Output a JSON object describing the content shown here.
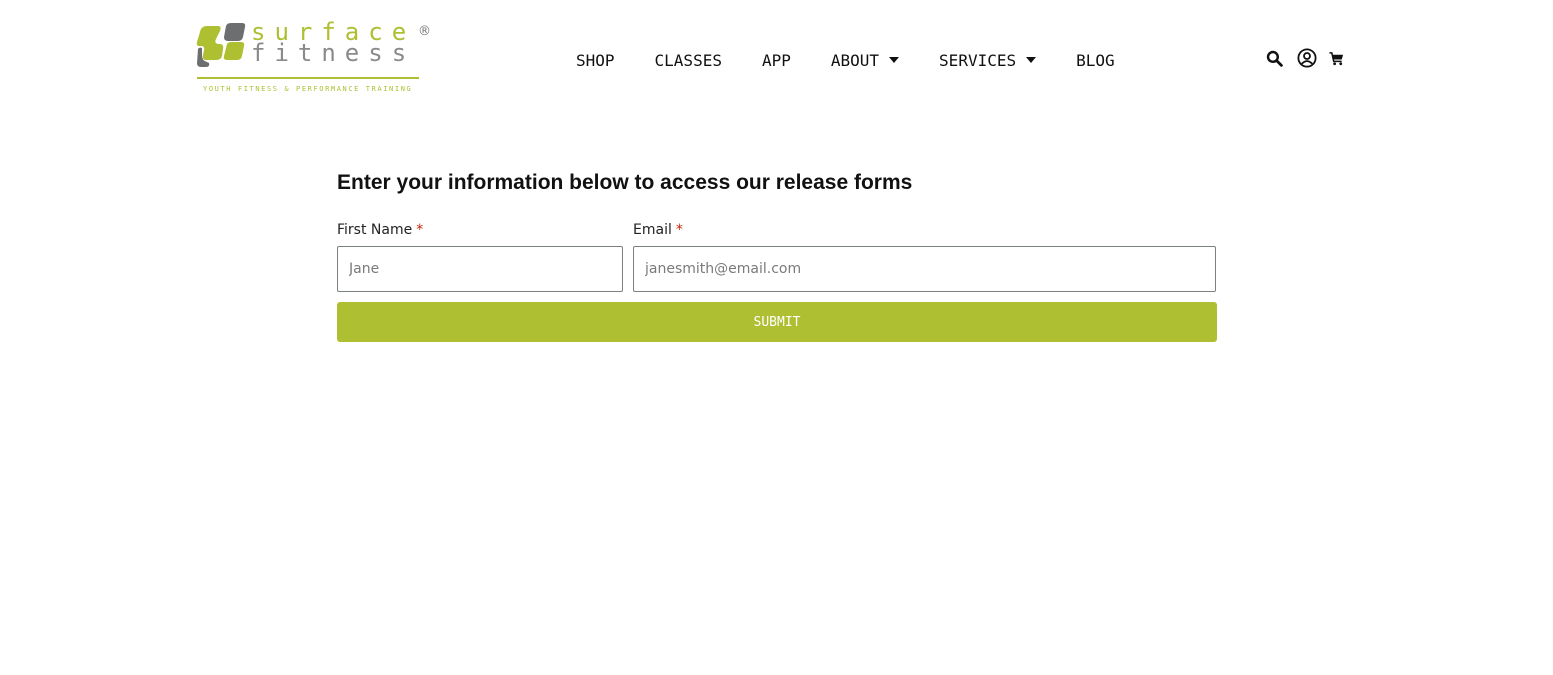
{
  "brand": {
    "name_line1": "surface",
    "name_line2": "fitness",
    "registered": "®",
    "tagline": "YOUTH FITNESS & PERFORMANCE TRAINING",
    "primary_color": "#aebf32",
    "secondary_color": "#6d6e70"
  },
  "nav": {
    "items": [
      {
        "label": "SHOP",
        "has_dropdown": false
      },
      {
        "label": "CLASSES",
        "has_dropdown": false
      },
      {
        "label": "APP",
        "has_dropdown": false
      },
      {
        "label": "ABOUT",
        "has_dropdown": true
      },
      {
        "label": "SERVICES",
        "has_dropdown": true
      },
      {
        "label": "BLOG",
        "has_dropdown": false
      }
    ]
  },
  "header_icons": {
    "search": "search-icon",
    "account": "user-circle-icon",
    "cart": "cart-icon"
  },
  "form": {
    "title": "Enter your information below to access our release forms",
    "fields": {
      "first_name": {
        "label": "First Name",
        "required_marker": "*",
        "value": "",
        "placeholder": "Jane"
      },
      "email": {
        "label": "Email",
        "required_marker": "*",
        "value": "",
        "placeholder": "janesmith@email.com"
      }
    },
    "submit_label": "SUBMIT",
    "required_color": "#cc2200"
  }
}
